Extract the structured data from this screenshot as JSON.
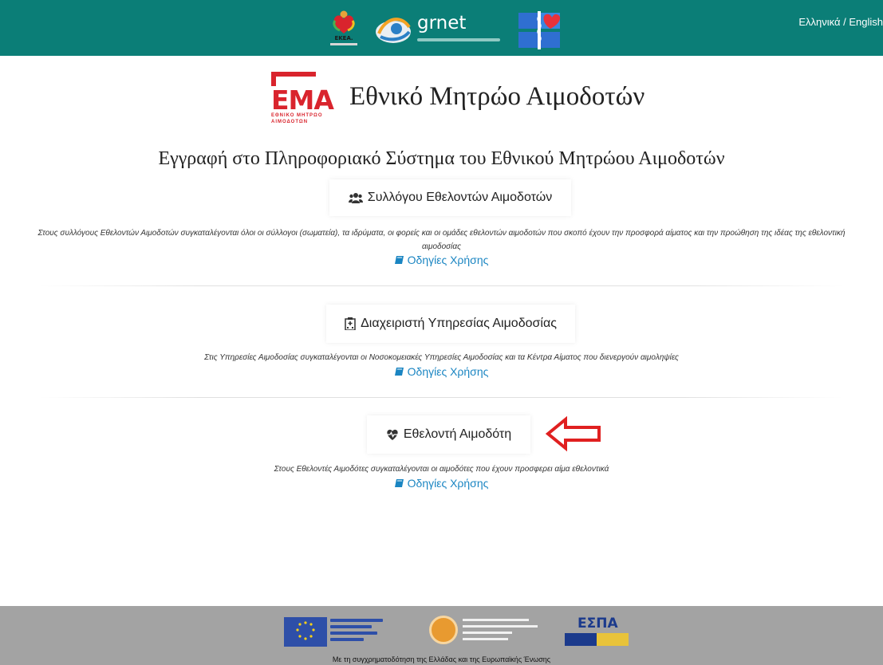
{
  "header": {
    "language_switch": "Ελληνικά / English",
    "bg_color": "#0b7e77",
    "logos": {
      "ekea": "ΕΚΕΑ.",
      "grnet": "grnet"
    }
  },
  "brand": {
    "logo_text": "ΕΜΑ",
    "logo_subtitle_line1": "ΕΘΝΙΚΟ ΜΗΤΡΩΟ",
    "logo_subtitle_line2": "ΑΙΜΟΔΟΤΩΝ",
    "title": "Εθνικό Μητρώο Αιμοδοτών",
    "accent_color": "#d9242d"
  },
  "registration": {
    "heading": "Εγγραφή στο Πληροφοριακό Σύστημα του Εθνικού Μητρώου Αιμοδοτών",
    "sections": [
      {
        "button_label": "Συλλόγου Εθελοντών Αιμοδοτών",
        "icon": "group-icon",
        "description": "Στους συλλόγους Εθελοντών Αιμοδοτών συγκαταλέγονται όλοι οι σύλλογοι (σωματεία), τα ιδρύματα, οι φορείς και οι ομάδες εθελοντών αιμοδοτών που σκοπό έχουν την προσφορά αίματος και την προώθηση της ιδέας της εθελοντική αιμοδοσίας",
        "manual_link": "Οδηγίες Χρήσης"
      },
      {
        "button_label": "Διαχειριστή Υπηρεσίας Αιμοδοσίας",
        "icon": "hospital-icon",
        "description": "Στις Υπηρεσίες Αιμοδοσίας συγκαταλέγονται οι Νοσοκομειακές Υπηρεσίες Αιμοδοσίας και τα Κέντρα Αίματος που διενεργούν αιμοληψίες",
        "manual_link": "Οδηγίες Χρήσης"
      },
      {
        "button_label": "Εθελοντή Αιμοδότη",
        "icon": "heartbeat-icon",
        "description": "Στους Εθελοντές Αιμοδότες συγκαταλέγονται οι αιμοδότες που έχουν προσφερει αίμα εθελοντικά",
        "manual_link": "Οδηγίες Χρήσης"
      }
    ],
    "link_color": "#1a85c2"
  },
  "annotation": {
    "arrow_color": "#e02020"
  },
  "footer": {
    "bg_color": "#a3a3a3",
    "cofunding_text": "Με τη συγχρηματοδότηση της Ελλάδας και της Ευρωπαϊκής Ένωσης",
    "espa_logo": "ΕΣΠΑ"
  }
}
